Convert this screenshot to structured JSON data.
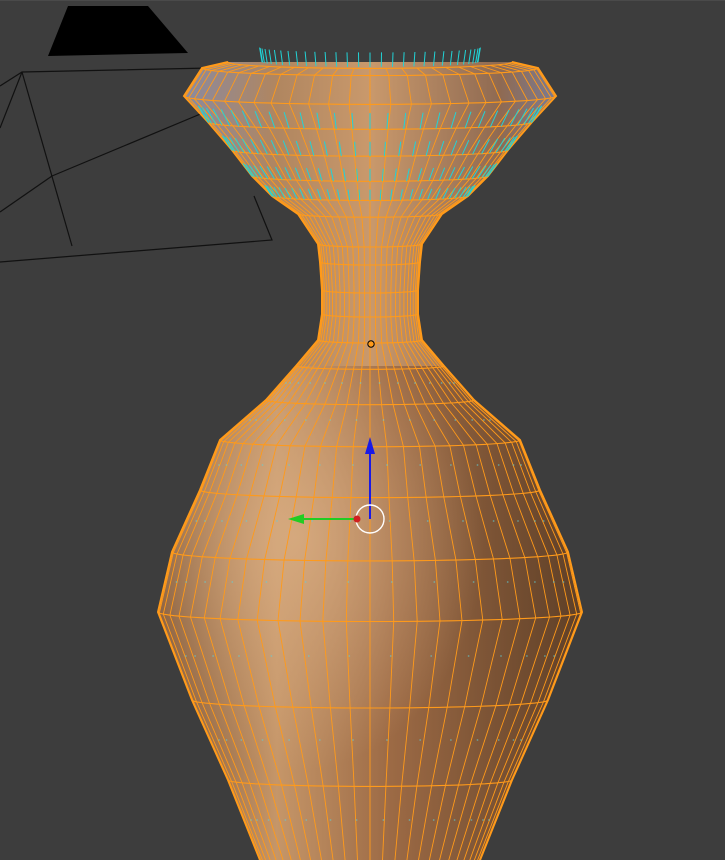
{
  "viewport": {
    "mode": "3d-view-edit-mode",
    "background_color": "#3d3d3d"
  },
  "colors": {
    "wire_selected": "#ff9a1a",
    "normals": "#22d3d6",
    "surface_light": "#c08f63",
    "surface_mid": "#a47049",
    "surface_dark": "#6e4a2e",
    "camera_lines": "#111111",
    "gizmo_z": "#1a1ae6",
    "gizmo_y": "#22cc22",
    "gizmo_origin": "#d02020",
    "cursor_ring": "#ffffff"
  },
  "objects": {
    "mesh": "vase-mesh",
    "camera": "camera-object",
    "gizmo": "translate-gizmo",
    "pivot": "object-origin"
  }
}
